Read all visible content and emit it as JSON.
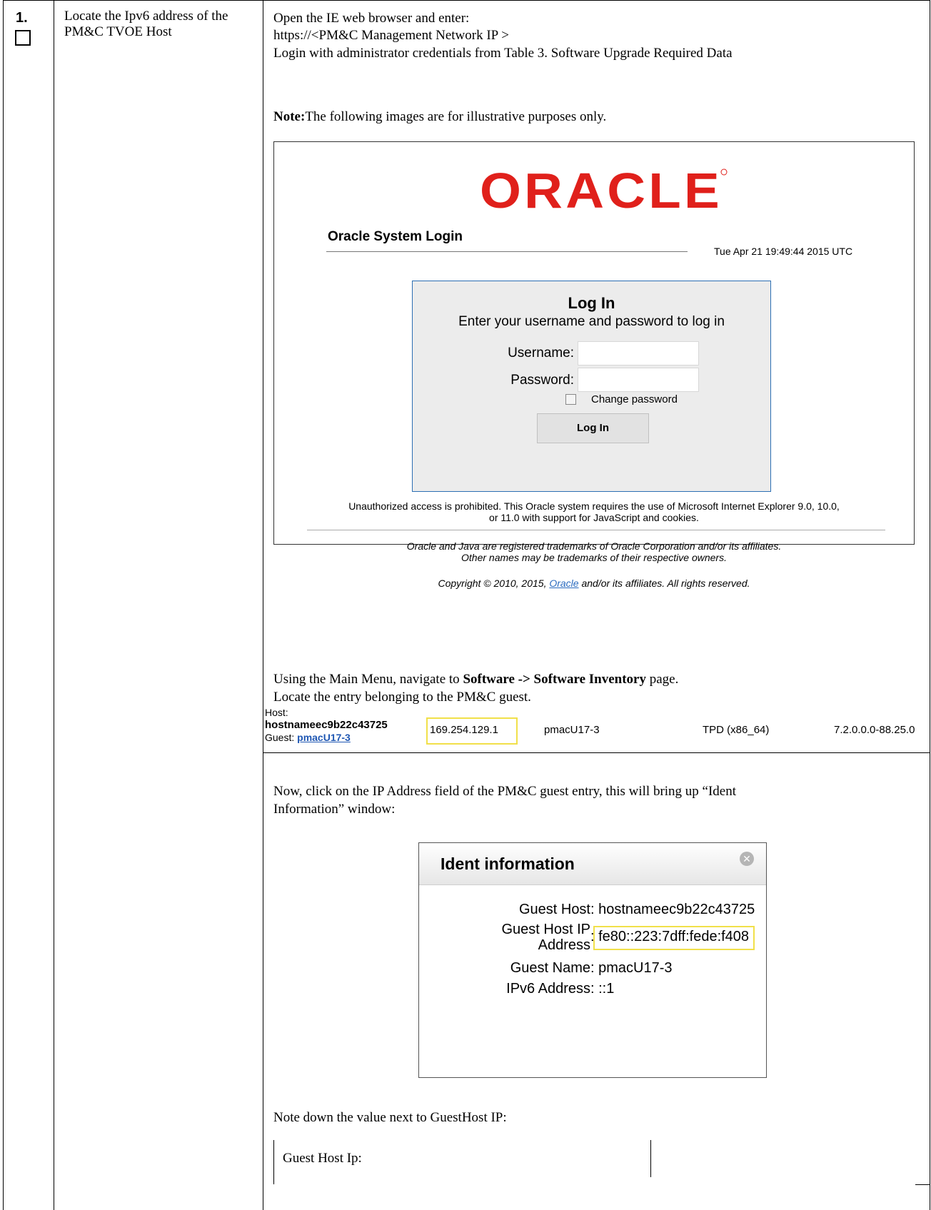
{
  "step": {
    "number": "1.",
    "description": "Locate the Ipv6 address of the PM&C TVOE Host"
  },
  "instructions": {
    "open_browser": "Open the IE web browser and enter:",
    "url": "https://<PM&C Management Network IP >",
    "login": "Login with administrator credentials from Table 3. Software Upgrade Required Data",
    "note_label": "Note:",
    "note_text": "The following images are for illustrative purposes only."
  },
  "login_screen": {
    "logo": "ORACLE",
    "title": "Oracle System Login",
    "timestamp": "Tue Apr 21 19:49:44 2015 UTC",
    "box_title": "Log In",
    "box_subtitle": "Enter your username and password to log in",
    "username_label": "Username:",
    "password_label": "Password:",
    "change_password_label": "Change password",
    "login_button": "Log In",
    "warning_line1": "Unauthorized access is prohibited. This Oracle system requires the use of Microsoft Internet Explorer 9.0, 10.0,",
    "warning_line2": "or 11.0 with support for JavaScript and cookies.",
    "trademark_line1": "Oracle and Java are registered trademarks of Oracle Corporation and/or its affiliates.",
    "trademark_line2": "Other names may be trademarks of their respective owners.",
    "copyright_pre": "Copyright © 2010, 2015, ",
    "copyright_link": "Oracle",
    "copyright_post": " and/or its affiliates. All rights reserved."
  },
  "navigate": {
    "pre": "Using the Main Menu, navigate to ",
    "bold": "Software -> Software Inventory",
    "post": " page.",
    "locate": "Locate the entry belonging to the PM&C guest."
  },
  "inventory_row": {
    "host_label": "Host:",
    "host_name": "hostnameec9b22c43725",
    "guest_label": "Guest: ",
    "guest_name": "pmacU17-3",
    "ip": "169.254.129.1",
    "name": "pmacU17-3",
    "platform": "TPD (x86_64)",
    "version": "7.2.0.0.0-88.25.0"
  },
  "click_instruction": {
    "line1": "Now, click on the IP Address field of the  PM&C guest entry, this will bring up “Ident",
    "line2": "Information” window:"
  },
  "ident_dialog": {
    "title": "Ident information",
    "rows": [
      {
        "key": "Guest Host",
        "value": "hostnameec9b22c43725"
      },
      {
        "key": "Guest Host IP",
        "key2": "Address",
        "value": "fe80::223:7dff:fede:f408"
      },
      {
        "key": "Guest Name",
        "value": "pmacU17-3"
      },
      {
        "key": "IPv6 Address",
        "value": "::1"
      }
    ]
  },
  "record": {
    "instruction": "Note down the value next to GuestHost IP:",
    "field_label": "Guest Host Ip:"
  },
  "colors": {
    "oracle_red": "#e0201b",
    "highlight_yellow": "#f1e04a",
    "link_blue": "#1f57b3"
  }
}
